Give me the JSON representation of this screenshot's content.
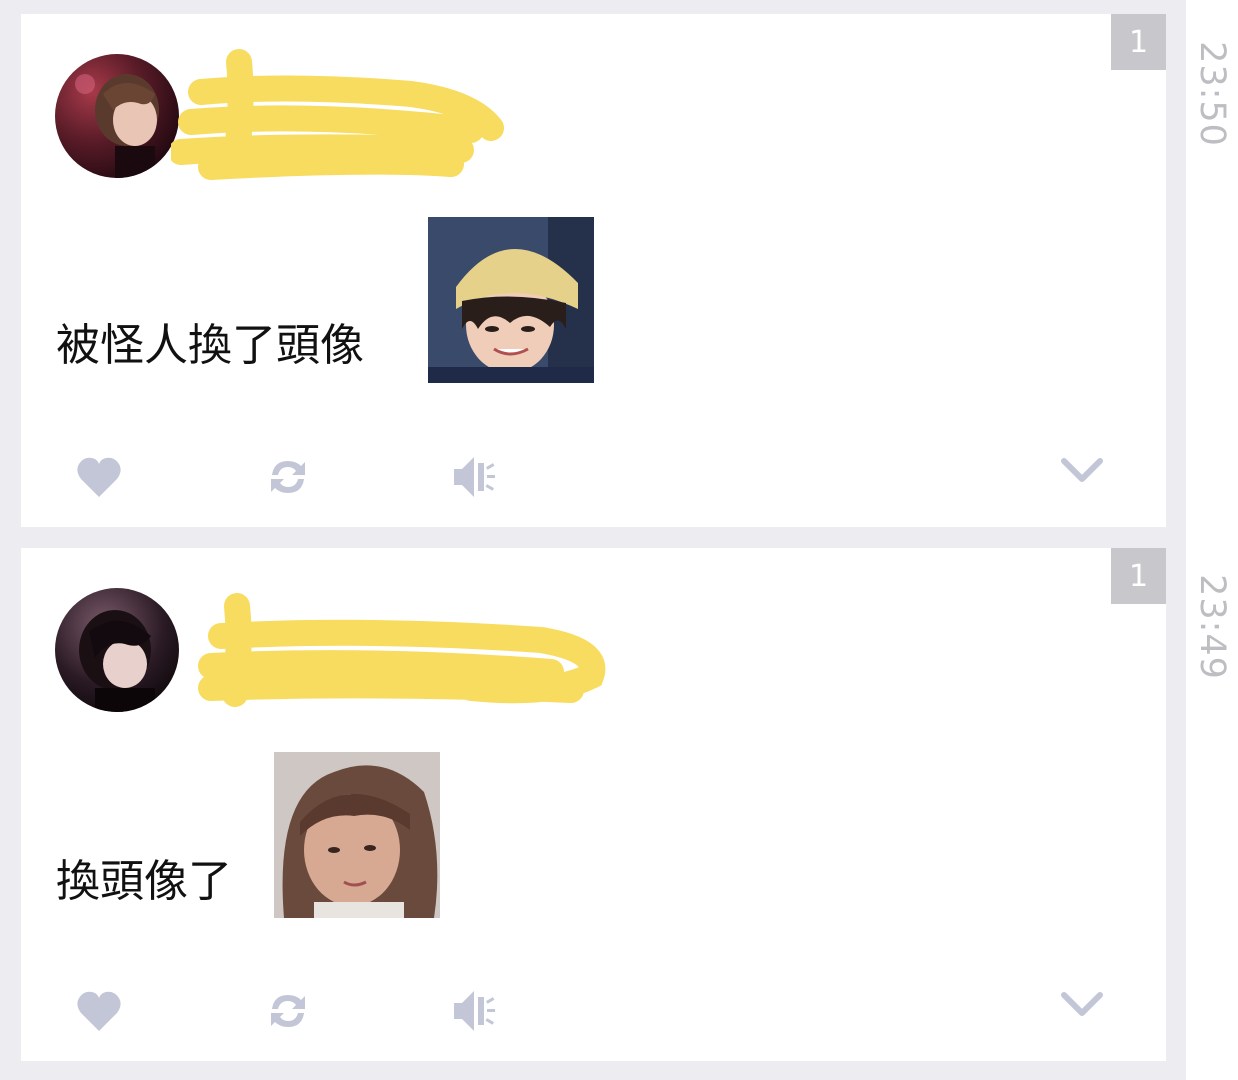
{
  "posts": [
    {
      "count": "1",
      "time": "23:50",
      "text": "被怪人換了頭像",
      "icons": {
        "like": "heart-icon",
        "retweet": "retweet-icon",
        "speak": "speaker-icon",
        "more": "chevron-down-icon"
      }
    },
    {
      "count": "1",
      "time": "23:49",
      "text": "換頭像了",
      "icons": {
        "like": "heart-icon",
        "retweet": "retweet-icon",
        "speak": "speaker-icon",
        "more": "chevron-down-icon"
      }
    }
  ],
  "colors": {
    "background": "#edecf1",
    "card": "#ffffff",
    "icon": "#c3c6d6",
    "redaction": "#f7dc5f",
    "badge": "#c8c8cc",
    "time": "#bdbdc2"
  }
}
